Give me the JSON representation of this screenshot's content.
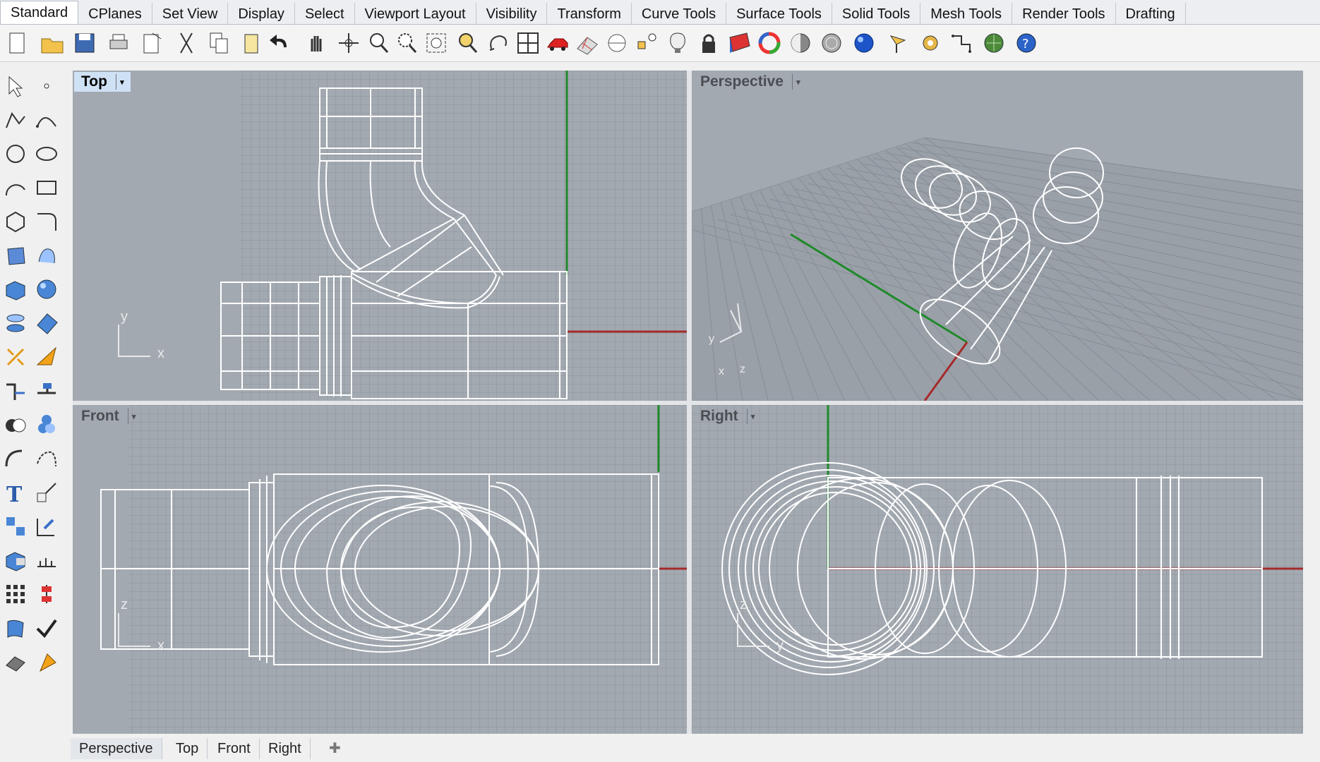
{
  "tabs": [
    "Standard",
    "CPlanes",
    "Set View",
    "Display",
    "Select",
    "Viewport Layout",
    "Visibility",
    "Transform",
    "Curve Tools",
    "Surface Tools",
    "Solid Tools",
    "Mesh Tools",
    "Render Tools",
    "Drafting"
  ],
  "active_tab": "Standard",
  "toolbar_icons": [
    "new-file-icon",
    "open-folder-icon",
    "save-icon",
    "print-icon",
    "import-icon",
    "cut-icon",
    "copy-icon",
    "paste-icon",
    "undo-icon",
    "pan-hand-icon",
    "rotate-view-icon",
    "zoom-dynamic-icon",
    "zoom-window-icon",
    "zoom-extents-icon",
    "zoom-selected-icon",
    "undo-view-icon",
    "four-viewports-icon",
    "named-view-car-icon",
    "cplane-grid-icon",
    "snap-circle-icon",
    "object-snap-icon",
    "lightbulb-icon",
    "lock-icon",
    "layer-icon",
    "color-wheel-icon",
    "shaded-sphere-icon",
    "render-preview-icon",
    "render-sphere-icon",
    "light-icon",
    "options-gear-icon",
    "dimensions-icon",
    "plugin-globe-icon",
    "help-icon"
  ],
  "side_icons": [
    "select-arrow-icon",
    "point-icon",
    "polyline-icon",
    "curve-icon",
    "circle-icon",
    "ellipse-icon",
    "arc-icon",
    "rectangle-icon",
    "polygon-icon",
    "fillet-curve-icon",
    "surface-icon",
    "loft-icon",
    "box-icon",
    "sphere-icon",
    "revolve-icon",
    "patch-icon",
    "explode-icon",
    "split-icon",
    "extend-icon",
    "trim-icon",
    "boolean-union-icon",
    "boolean-split-icon",
    "fillet-icon",
    "blend-icon",
    "text-icon",
    "scale-icon",
    "group-icon",
    "move-icon",
    "solid-edit-icon",
    "dimension-icon",
    "array-icon",
    "align-icon",
    "drape-icon",
    "check-icon",
    "mesh-icon",
    "analysis-icon"
  ],
  "viewports": {
    "top": {
      "label": "Top",
      "axis_a": "y",
      "axis_b": "x"
    },
    "perspective": {
      "label": "Perspective",
      "axis_a": "y",
      "axis_b": "x",
      "axis_c": "z"
    },
    "front": {
      "label": "Front",
      "axis_a": "z",
      "axis_b": "x"
    },
    "right": {
      "label": "Right",
      "axis_a": "z",
      "axis_b": "y"
    }
  },
  "bottom_tabs": [
    "Perspective",
    "Top",
    "Front",
    "Right"
  ],
  "plus_label": "✚",
  "dropdown_glyph": "▾",
  "colors": {
    "viewport_bg": "#a3a9b1",
    "grid_line": "#8d939b",
    "wire": "#ffffff",
    "x_axis": "#a52a2a",
    "y_axis": "#1f8a2a",
    "active_label": "#cfe1f5"
  }
}
